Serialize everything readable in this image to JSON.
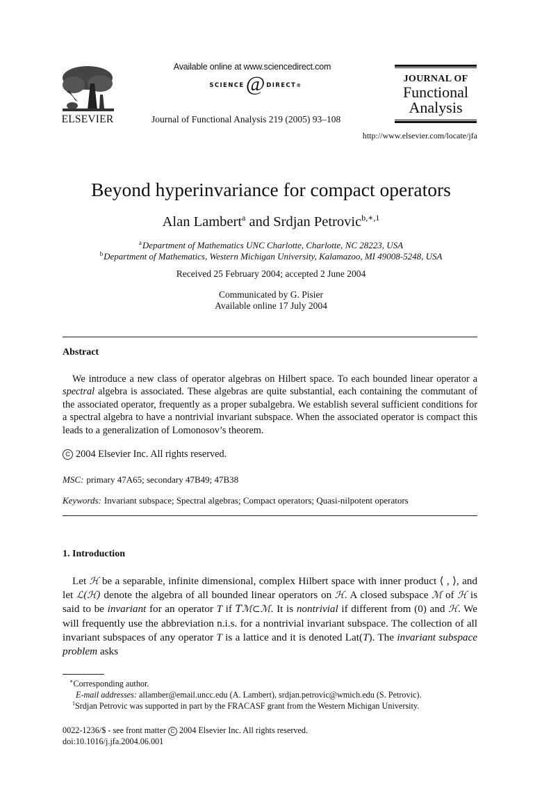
{
  "header": {
    "publisher_logo": "elsevier-tree-logo",
    "publisher_name": "ELSEVIER",
    "available_online": "Available online at www.sciencedirect.com",
    "sciencedirect_left": "SCIENCE",
    "sciencedirect_at": "d",
    "sciencedirect_right": "DIRECT",
    "sciencedirect_mark": "®",
    "citation": "Journal of Functional Analysis 219 (2005) 93–108",
    "journal_name_line1": "JOURNAL OF",
    "journal_name_line2": "Functional",
    "journal_name_line3": "Analysis",
    "journal_url": "http://www.elsevier.com/locate/jfa"
  },
  "article": {
    "title": "Beyond hyperinvariance for compact operators",
    "author1": "Alan Lambert",
    "author1_sup": "a",
    "author_conj": " and ",
    "author2": "Srdjan Petrovic",
    "author2_sup": "b,∗,1",
    "affiliations": [
      {
        "mark": "a",
        "text": "Department of Mathematics UNC Charlotte, Charlotte, NC 28223, USA"
      },
      {
        "mark": "b",
        "text": "Department of Mathematics, Western Michigan University, Kalamazoo, MI 49008-5248, USA"
      }
    ],
    "dates": "Received 25 February 2004; accepted 2 June 2004",
    "communicated": "Communicated by G. Pisier",
    "available": "Available online 17 July 2004"
  },
  "abstract": {
    "heading": "Abstract",
    "text_1": "We introduce a new class of operator algebras on Hilbert space. To each bounded linear operator a ",
    "text_em": "spectral",
    "text_2": " algebra is associated. These algebras are quite substantial, each containing the commutant of the associated operator, frequently as a proper subalgebra. We establish several sufficient conditions for a spectral algebra to have a nontrivial invariant subspace. When the associated operator is compact this leads to a generalization of Lomonosov’s theorem.",
    "copyright_symbol": "C",
    "copyright": "2004 Elsevier Inc. All rights reserved.",
    "msc_label": "MSC:",
    "msc": "primary 47A65; secondary 47B49; 47B38",
    "keywords_label": "Keywords:",
    "keywords": "Invariant subspace; Spectral algebras; Compact operators; Quasi-nilpotent operators"
  },
  "introduction": {
    "heading": "1.  Introduction",
    "segments": {
      "s1": "Let ",
      "H1": "ℋ",
      "s2": " be a separable, infinite dimensional, complex Hilbert space with inner product ",
      "ip": "⟨ , ⟩",
      "s3": ", and let ",
      "LH": "ℒ(ℋ)",
      "s4": " denote the algebra of all bounded linear operators on ",
      "H2": "ℋ",
      "s5": ". A closed subspace ",
      "M1": "ℳ",
      "s6": " of ",
      "H3": "ℋ",
      "s7": " is said to be ",
      "em1": "invariant",
      "s8": " for an operator ",
      "T1": "T",
      "s9": " if ",
      "TM": "Tℳ⊂ℳ",
      "s10": ". It is ",
      "em2": "nontrivial",
      "s11": " if different from (0) and ",
      "H4": "ℋ",
      "s12": ". We will frequently use the abbreviation n.i.s. for a nontrivial invariant subspace. The collection of all invariant subspaces of any operator ",
      "T2": "T",
      "s13": " is a lattice and it is denoted Lat(",
      "T3": "T",
      "s14": "). The ",
      "em3": "invariant subspace problem",
      "s15": " asks"
    }
  },
  "footnotes": {
    "corresponding_mark": "∗",
    "corresponding": "Corresponding author.",
    "email_label": "E-mail addresses:",
    "emails": " allamber@email.uncc.edu (A. Lambert), srdjan.petrovic@wmich.edu (S. Petrovic).",
    "fn1_mark": "1",
    "fn1": "Srdjan Petrovic was supported in part by the FRACASF grant from the Western Michigan University."
  },
  "bottom": {
    "issn": "0022-1236/$ - see front matter",
    "copyright_symbol": "C",
    "copyright": "2004 Elsevier Inc. All rights reserved.",
    "doi": "doi:10.1016/j.jfa.2004.06.001"
  }
}
